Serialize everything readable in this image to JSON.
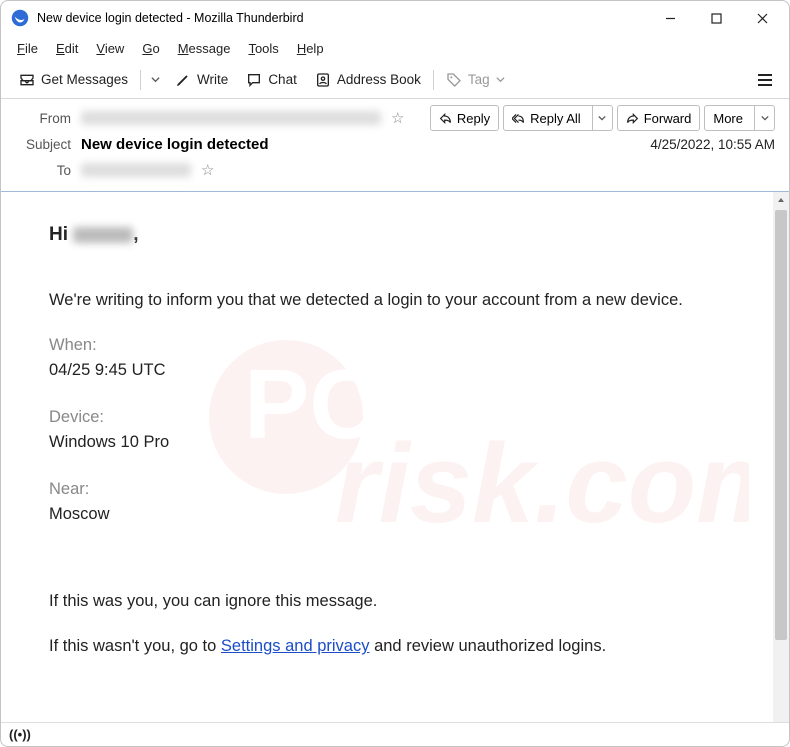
{
  "window": {
    "title": "New device login detected - Mozilla Thunderbird"
  },
  "menubar": {
    "file": "File",
    "edit": "Edit",
    "view": "View",
    "go": "Go",
    "message": "Message",
    "tools": "Tools",
    "help": "Help"
  },
  "toolbar": {
    "get_messages": "Get Messages",
    "write": "Write",
    "chat": "Chat",
    "address_book": "Address Book",
    "tag": "Tag"
  },
  "headers": {
    "from_label": "From",
    "subject_label": "Subject",
    "to_label": "To",
    "subject_value": "New device login detected",
    "date": "4/25/2022, 10:55 AM",
    "reply": "Reply",
    "reply_all": "Reply All",
    "forward": "Forward",
    "more": "More"
  },
  "body": {
    "hi": "Hi ",
    "greet_comma": ",",
    "intro": "We're writing to inform you that we detected a login to your account from a new device.",
    "when_label": "When:",
    "when_value": "04/25 9:45 UTC",
    "device_label": "Device:",
    "device_value": "Windows 10 Pro",
    "near_label": "Near:",
    "near_value": "Moscow",
    "if_you": "If this was you, you can ignore this message.",
    "if_not_pre": "If this wasn't you, go to ",
    "if_not_link": "Settings and privacy",
    "if_not_post": " and review unauthorized logins."
  },
  "status": {
    "signal": "((•))"
  }
}
